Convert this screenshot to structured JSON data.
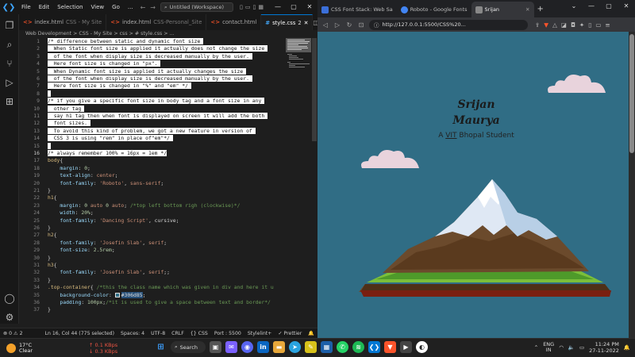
{
  "vscode": {
    "menu": [
      "File",
      "Edit",
      "Selection",
      "View",
      "Go",
      "..."
    ],
    "command_center": "Untitled (Workspace)",
    "tabs": [
      {
        "name": "index.html",
        "desc": "CSS - My Site",
        "icon": "html-icon",
        "color": "#e44d26",
        "active": false
      },
      {
        "name": "index.html",
        "desc": "CSS-Personal_Site",
        "icon": "html-icon",
        "color": "#e44d26",
        "active": false
      },
      {
        "name": "contact.html",
        "desc": "",
        "icon": "html-icon",
        "color": "#e44d26",
        "active": false
      },
      {
        "name": "style.css",
        "desc": "",
        "badge": "2",
        "icon": "css-icon",
        "color": "#42a5f5",
        "active": true
      }
    ],
    "breadcrumb": "Web Development > CSS - My Site > css > # style.css > ...",
    "current_line": 16,
    "lines": [
      {
        "n": 1,
        "segs": [
          [
            "sel",
            "/* difference between static and dynamic font size "
          ]
        ]
      },
      {
        "n": 2,
        "segs": [
          [
            "sel",
            "  When Static font size is applied it actually does not change the size "
          ]
        ]
      },
      {
        "n": 3,
        "segs": [
          [
            "sel",
            "  of the font when display size is decreased manually by the user. "
          ]
        ]
      },
      {
        "n": 4,
        "segs": [
          [
            "sel",
            "  Here font size is changed in \"px\". "
          ]
        ]
      },
      {
        "n": 5,
        "segs": [
          [
            "sel",
            "  When Dynamic font size is applied it actually changes the size "
          ]
        ]
      },
      {
        "n": 6,
        "segs": [
          [
            "sel",
            "  of the font when display size is decreased manually by the user. "
          ]
        ]
      },
      {
        "n": 7,
        "segs": [
          [
            "sel",
            "  Here font size is changed in \"%\" and \"em\" */ "
          ]
        ]
      },
      {
        "n": 8,
        "segs": [
          [
            "sel",
            " "
          ]
        ]
      },
      {
        "n": 9,
        "segs": [
          [
            "sel",
            "/* if you give a specific font size in body tag and a font size in any "
          ]
        ]
      },
      {
        "n": 10,
        "segs": [
          [
            "sel",
            "  other tag "
          ]
        ]
      },
      {
        "n": 11,
        "segs": [
          [
            "sel",
            "  say h1 tag then when font is displayed on screen it will add the both "
          ]
        ]
      },
      {
        "n": 12,
        "segs": [
          [
            "sel",
            "  font sizes. "
          ]
        ]
      },
      {
        "n": 13,
        "segs": [
          [
            "sel",
            "  To avoid this kind of problem, we got a new feature in version of "
          ]
        ]
      },
      {
        "n": 14,
        "segs": [
          [
            "sel",
            "  CSS 3 is using \"rem\" in place of\"em\"*/ "
          ]
        ]
      },
      {
        "n": 15,
        "segs": [
          [
            "sel",
            " "
          ]
        ]
      },
      {
        "n": 16,
        "segs": [
          [
            "sel",
            "/* always remember 100% = 16px = 1em */"
          ]
        ]
      },
      {
        "n": 17,
        "segs": [
          [
            "sl",
            "body"
          ],
          [
            "pu",
            "{"
          ]
        ]
      },
      {
        "n": 18,
        "segs": [
          [
            "pr",
            "    margin"
          ],
          [
            "pu",
            ": "
          ],
          [
            "nm",
            "0"
          ],
          [
            "pu",
            ";"
          ]
        ]
      },
      {
        "n": 19,
        "segs": [
          [
            "pr",
            "    text-align"
          ],
          [
            "pu",
            ": "
          ],
          [
            "vl",
            "center"
          ],
          [
            "pu",
            ";"
          ]
        ]
      },
      {
        "n": 20,
        "segs": [
          [
            "pr",
            "    font-family"
          ],
          [
            "pu",
            ": "
          ],
          [
            "vl",
            "'Roboto'"
          ],
          [
            "pu",
            ", "
          ],
          [
            "vl",
            "sans-serif"
          ],
          [
            "pu",
            ";"
          ]
        ]
      },
      {
        "n": 21,
        "segs": [
          [
            "pu",
            "}"
          ]
        ]
      },
      {
        "n": 22,
        "segs": [
          [
            "sl",
            "h1"
          ],
          [
            "pu",
            "{"
          ]
        ]
      },
      {
        "n": 23,
        "segs": [
          [
            "pr",
            "    margin"
          ],
          [
            "pu",
            ": "
          ],
          [
            "nm",
            "0"
          ],
          [
            "vl",
            " auto "
          ],
          [
            "nm",
            "0"
          ],
          [
            "vl",
            " auto"
          ],
          [
            "pu",
            "; "
          ],
          [
            "cm",
            "/*top left bottom righ (clockwise)*/"
          ]
        ]
      },
      {
        "n": 24,
        "segs": [
          [
            "pr",
            "    width"
          ],
          [
            "pu",
            ": "
          ],
          [
            "nm",
            "20%"
          ],
          [
            "pu",
            ";"
          ]
        ]
      },
      {
        "n": 25,
        "segs": [
          [
            "pr",
            "    font-family"
          ],
          [
            "pu",
            ": "
          ],
          [
            "vl",
            "'Dancing Script'"
          ],
          [
            "pu",
            ", cursive;"
          ]
        ]
      },
      {
        "n": 26,
        "segs": [
          [
            "pu",
            "}"
          ]
        ]
      },
      {
        "n": 27,
        "segs": [
          [
            "sl",
            "h2"
          ],
          [
            "pu",
            "{"
          ]
        ]
      },
      {
        "n": 28,
        "segs": [
          [
            "pr",
            "    font-family"
          ],
          [
            "pu",
            ": "
          ],
          [
            "vl",
            "'Josefin Slab'"
          ],
          [
            "pu",
            ", "
          ],
          [
            "vl",
            "serif"
          ],
          [
            "pu",
            ";"
          ]
        ]
      },
      {
        "n": 29,
        "segs": [
          [
            "pr",
            "    font-size"
          ],
          [
            "pu",
            ": "
          ],
          [
            "nm",
            "2.5rem"
          ],
          [
            "pu",
            ";"
          ]
        ]
      },
      {
        "n": 30,
        "segs": [
          [
            "pu",
            "}"
          ]
        ]
      },
      {
        "n": 31,
        "segs": [
          [
            "sl",
            "h3"
          ],
          [
            "pu",
            "{"
          ]
        ]
      },
      {
        "n": 32,
        "segs": [
          [
            "pr",
            "    font-family"
          ],
          [
            "pu",
            ": "
          ],
          [
            "vl",
            "'Josefin Slab'"
          ],
          [
            "pu",
            ", "
          ],
          [
            "vl",
            "serif"
          ],
          [
            "pu",
            ";;"
          ]
        ]
      },
      {
        "n": 33,
        "segs": [
          [
            "pu",
            "}"
          ]
        ]
      },
      {
        "n": 34,
        "segs": [
          [
            "sl",
            ".top-container"
          ],
          [
            "pu",
            "{ "
          ],
          [
            "cm",
            "/*this the class name which was given in div and here it u"
          ]
        ]
      },
      {
        "n": 35,
        "segs": [
          [
            "pr",
            "    background-color"
          ],
          [
            "pu",
            ": "
          ],
          [
            "swatch",
            "#306d85"
          ],
          [
            "pu",
            ";"
          ]
        ]
      },
      {
        "n": 36,
        "segs": [
          [
            "pr",
            "    padding"
          ],
          [
            "pu",
            ": "
          ],
          [
            "nm",
            "100px"
          ],
          [
            "pu",
            ";"
          ],
          [
            "cm",
            "/*it is used to give a space between text and border*/"
          ]
        ]
      },
      {
        "n": 37,
        "segs": [
          [
            "pu",
            "}"
          ]
        ]
      }
    ],
    "status": {
      "problems": "⊗ 0 ⚠ 2",
      "position": "Ln 16, Col 44 (775 selected)",
      "spaces": "Spaces: 4",
      "encoding": "UTF-8",
      "eol": "CRLF",
      "lang": "{} CSS",
      "port": "Port : 5500",
      "stylelint": "Stylelint+",
      "prettier": "✓ Prettier"
    }
  },
  "browser": {
    "tabs": [
      {
        "title": "CSS Font Stack: Web Sa",
        "fav": "#3b6fd9",
        "active": false
      },
      {
        "title": "Roboto - Google Fonts",
        "fav": "#4285f4",
        "active": false
      },
      {
        "title": "Srijan",
        "fav": "#888888",
        "active": true
      }
    ],
    "url": "http://127.0.0.1:5500/CSS%20...",
    "page": {
      "h1_line1": "Srijan",
      "h1_line2": "Maurya",
      "h3_pre": "A ",
      "h3_u": "VIT",
      "h3_post": " Bhopal Student",
      "background": "#306d85"
    }
  },
  "taskbar": {
    "temp": "17°C",
    "weather": "Clear",
    "net_up": "↑ 0.1 KBps",
    "net_down": "↓ 0.3 KBps",
    "search": "Search",
    "lang1": "ENG",
    "lang2": "IN",
    "time": "11:24 PM",
    "date": "27-11-2022"
  }
}
